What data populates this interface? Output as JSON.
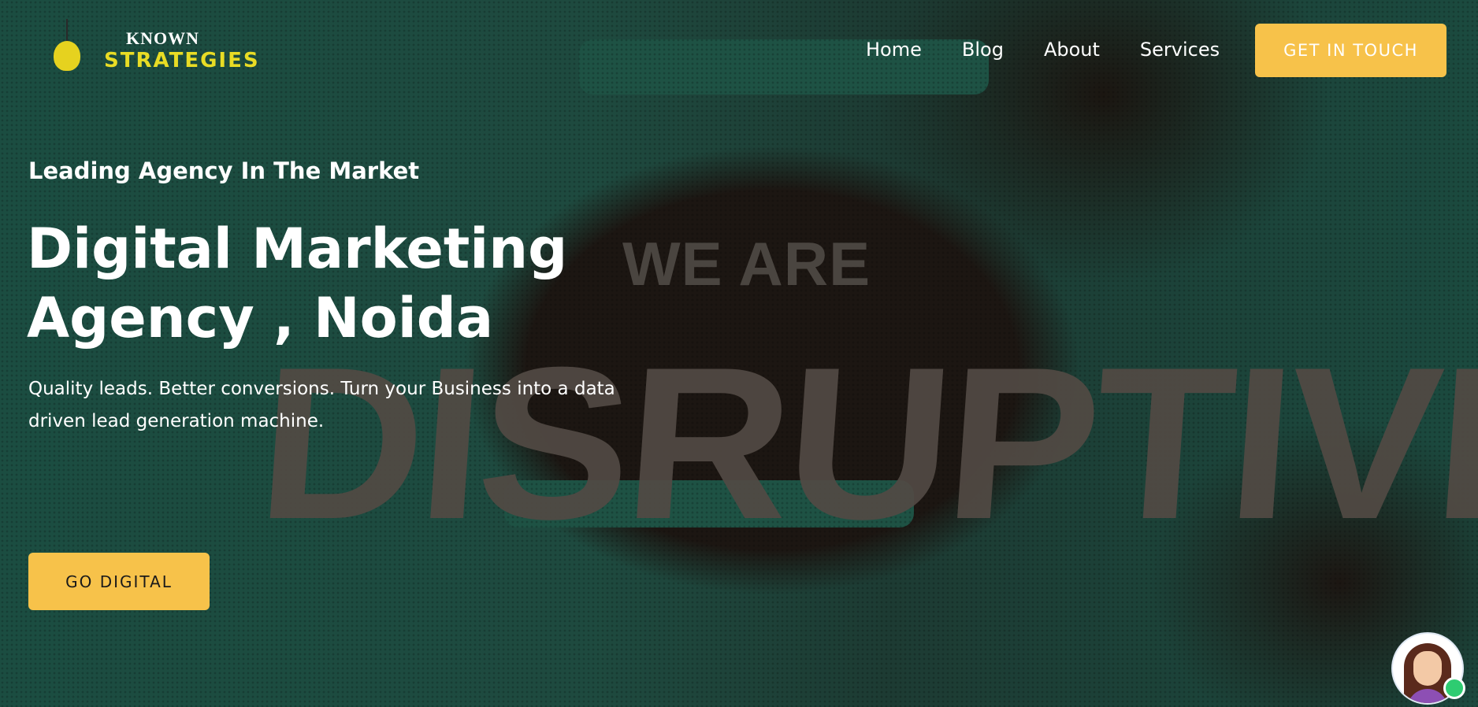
{
  "brand": {
    "line1": "KNOWN",
    "line2": "STRATEGIES",
    "icon": "lightbulb-icon"
  },
  "nav": {
    "items": [
      "Home",
      "Blog",
      "About",
      "Services"
    ]
  },
  "header": {
    "cta_label": "GET IN TOUCH"
  },
  "hero": {
    "eyebrow": "Leading Agency In The Market",
    "headline_line1": "Digital Marketing",
    "headline_line2": "Agency , Noida",
    "description": "Quality leads. Better conversions. Turn your Business into a data driven lead generation machine.",
    "cta_label": "GO DIGITAL",
    "bg_text_top": "WE ARE",
    "bg_text_main": "DISRUPTIVE"
  },
  "chat": {
    "avatar": "support-agent-avatar",
    "status": "online"
  },
  "colors": {
    "accent": "#f7c24a",
    "background": "#1b4a3f",
    "logo_yellow": "#e8dc25",
    "online": "#2ecc71"
  }
}
